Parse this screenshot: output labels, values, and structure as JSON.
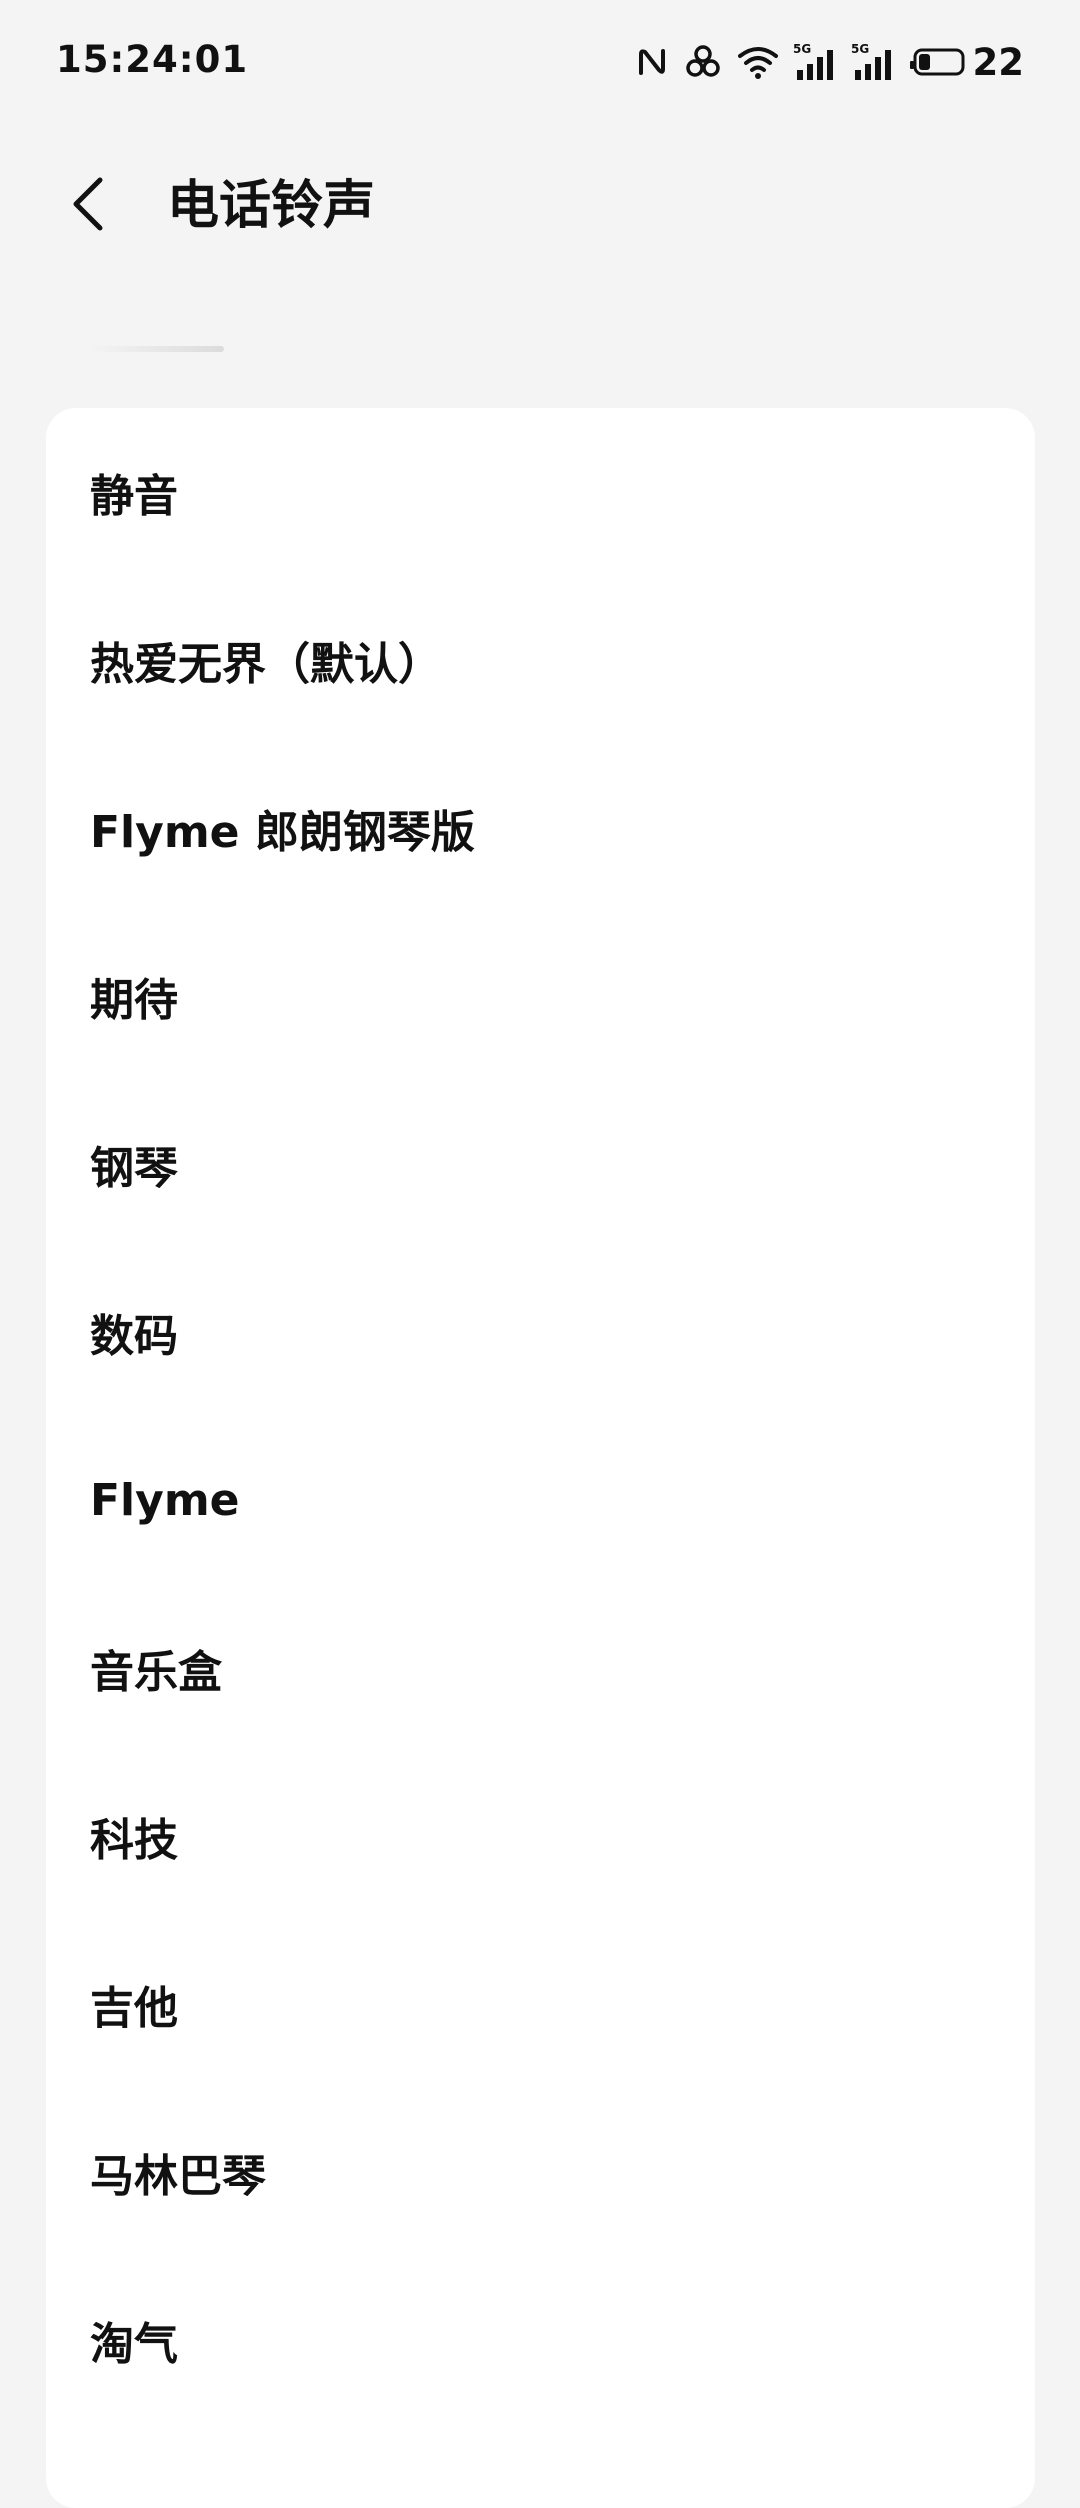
{
  "status_bar": {
    "time": "15:24:01",
    "battery_level": "22",
    "icons": [
      "nfc-icon",
      "link-icon",
      "wifi-icon",
      "signal-5g-sim1-icon",
      "signal-5g-sim2-icon",
      "battery-icon"
    ],
    "signal_label_1": "5G",
    "signal_label_2": "5G"
  },
  "header": {
    "back_icon": "chevron-left-icon",
    "title": "电话铃声"
  },
  "ringtones": [
    {
      "label": "静音"
    },
    {
      "label": "热爱无界（默认）"
    },
    {
      "label": "Flyme 郎朗钢琴版"
    },
    {
      "label": "期待"
    },
    {
      "label": "钢琴"
    },
    {
      "label": "数码"
    },
    {
      "label": "Flyme"
    },
    {
      "label": "音乐盒"
    },
    {
      "label": "科技"
    },
    {
      "label": "吉他"
    },
    {
      "label": "马林巴琴"
    },
    {
      "label": "淘气"
    }
  ],
  "colors": {
    "page_background": "#f4f4f4",
    "card_background": "#ffffff",
    "text": "#111111"
  }
}
